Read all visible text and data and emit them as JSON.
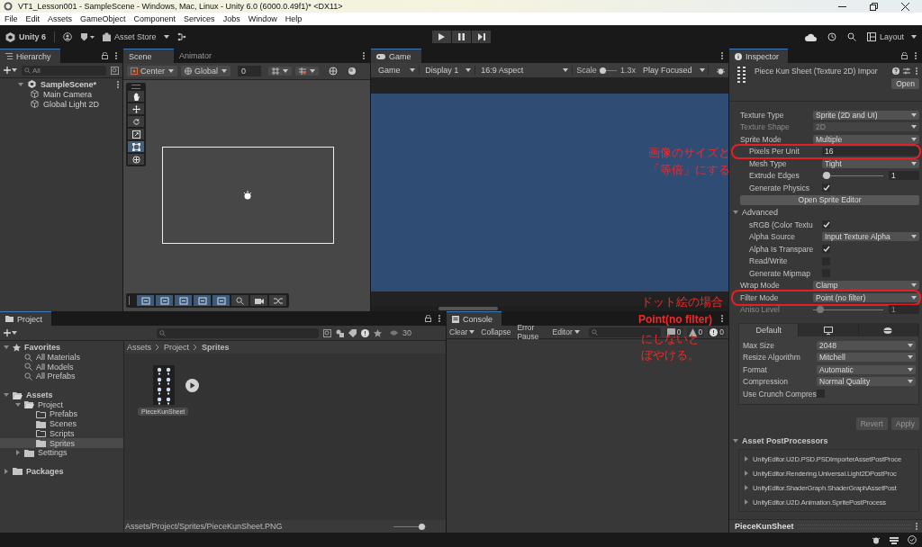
{
  "window": {
    "title": "VT1_Lesson001 - SampleScene - Windows, Mac, Linux - Unity 6.0 (6000.0.49f1)* <DX11>"
  },
  "menu": [
    "File",
    "Edit",
    "Assets",
    "GameObject",
    "Component",
    "Services",
    "Jobs",
    "Window",
    "Help"
  ],
  "toolbar": {
    "account": "Unity 6",
    "store": "Asset Store",
    "layout": "Layout"
  },
  "play_controls": [
    {
      "kind": "play"
    },
    {
      "kind": "pause"
    },
    {
      "kind": "step"
    }
  ],
  "hierarchy": {
    "tab": "Hierarchy",
    "search": {
      "placeholder": "All"
    },
    "tree": [
      {
        "label": "SampleScene*",
        "expanded": true,
        "children": [
          {
            "label": "Main Camera"
          },
          {
            "label": "Global Light 2D"
          }
        ]
      }
    ]
  },
  "scene": {
    "tabs": [
      {
        "label": "Scene",
        "selected": true
      },
      {
        "label": "Animator",
        "selected": false
      }
    ],
    "pivot": "Center",
    "space": "Global",
    "grid": "0",
    "tools": [
      {
        "kind": "hand",
        "selected": false
      },
      {
        "kind": "move",
        "selected": false
      },
      {
        "kind": "rotate",
        "selected": false
      },
      {
        "kind": "scale",
        "selected": false
      },
      {
        "kind": "rect",
        "selected": true
      },
      {
        "kind": "transform",
        "selected": false
      }
    ]
  },
  "game": {
    "tab": "Game",
    "view": "Game",
    "display": "Display 1",
    "aspect": "16:9 Aspect",
    "scale_label": "Scale",
    "scale": {
      "level": 0.12,
      "reading": "1.3x"
    },
    "mode": "Play Focused"
  },
  "inspector": {
    "tab": "Inspector",
    "title": "Piece Kun Sheet (Texture 2D) Impor",
    "open": "Open",
    "rows": [
      {
        "kind": "dropdown",
        "label": "Texture Type",
        "value": "Sprite (2D and UI)",
        "disabled": false,
        "annotated": false
      },
      {
        "kind": "dropdown",
        "label": "Texture Shape",
        "value": "2D",
        "disabled": true,
        "annotated": false
      },
      {
        "kind": "dropdown",
        "label": "Sprite Mode",
        "value": "Multiple",
        "disabled": false,
        "annotated": false,
        "children": [
          {
            "kind": "text",
            "label": "Pixels Per Unit",
            "value": "16",
            "disabled": false,
            "annotated": true
          },
          {
            "kind": "dropdown",
            "label": "Mesh Type",
            "value": "Tight",
            "disabled": false,
            "annotated": false
          },
          {
            "kind": "slider",
            "label": "Extrude Edges",
            "level": 0.02,
            "value": "1",
            "disabled": false,
            "annotated": false
          },
          {
            "kind": "checkbox",
            "label": "Generate Physics",
            "checked": true,
            "disabled": false,
            "annotated": false
          }
        ]
      },
      {
        "kind": "button",
        "label": "Open Sprite Editor"
      },
      {
        "kind": "foldout",
        "label": "Advanced",
        "expanded": true,
        "children": [
          {
            "kind": "checkbox",
            "label": "sRGB (Color Textu",
            "checked": true,
            "disabled": false,
            "annotated": false
          },
          {
            "kind": "dropdown",
            "label": "Alpha Source",
            "value": "Input Texture Alpha",
            "disabled": false,
            "annotated": false
          },
          {
            "kind": "checkbox",
            "label": "Alpha Is Transpare",
            "checked": true,
            "disabled": false,
            "annotated": false
          },
          {
            "kind": "checkbox",
            "label": "Read/Write",
            "checked": false,
            "disabled": false,
            "annotated": false
          },
          {
            "kind": "checkbox",
            "label": "Generate Mipmap",
            "checked": false,
            "disabled": false,
            "annotated": false
          }
        ]
      },
      {
        "kind": "dropdown",
        "label": "Wrap Mode",
        "value": "Clamp",
        "disabled": false,
        "annotated": false
      },
      {
        "kind": "dropdown",
        "label": "Filter Mode",
        "value": "Point (no filter)",
        "disabled": false,
        "annotated": true
      },
      {
        "kind": "slider",
        "label": "Aniso Level",
        "level": 0.05,
        "value": "1",
        "disabled": true,
        "annotated": false
      }
    ],
    "platform_tabs": [
      {
        "kind": "default",
        "label": "Default",
        "selected": true
      },
      {
        "kind": "standalone",
        "selected": false
      },
      {
        "kind": "web",
        "selected": false
      }
    ],
    "platform_rows": [
      {
        "kind": "dropdown",
        "label": "Max Size",
        "value": "2048"
      },
      {
        "kind": "dropdown",
        "label": "Resize Algorithm",
        "value": "Mitchell"
      },
      {
        "kind": "dropdown",
        "label": "Format",
        "value": "Automatic"
      },
      {
        "kind": "dropdown",
        "label": "Compression",
        "value": "Normal Quality"
      },
      {
        "kind": "checkbox",
        "label": "Use Crunch Compres",
        "checked": false
      }
    ],
    "actions": [
      {
        "label": "Revert",
        "disabled": true
      },
      {
        "label": "Apply",
        "disabled": true
      }
    ],
    "postprocessors": {
      "label": "Asset PostProcessors",
      "expanded": true,
      "items": [
        "UnityEditor.U2D.PSD.PSDImporterAssetPostProce",
        "UnityEditor.Rendering.Universal.Light2DPostProc",
        "UnityEditor.ShaderGraph.ShaderGraphAssetPost",
        "UnityEditor.U2D.Animation.SpritePostProcess"
      ]
    },
    "preview": "PieceKunSheet"
  },
  "project": {
    "tab": "Project",
    "count": "30",
    "tree": [
      {
        "kind": "star",
        "label": "Favorites",
        "expanded": true,
        "selected": false,
        "children": [
          {
            "kind": "search",
            "label": "All Materials",
            "selected": false
          },
          {
            "kind": "search",
            "label": "All Models",
            "selected": false
          },
          {
            "kind": "search",
            "label": "All Prefabs",
            "selected": false
          }
        ]
      },
      {
        "kind": "open-folder",
        "label": "Assets",
        "expanded": true,
        "selected": false,
        "children": [
          {
            "kind": "open-folder",
            "label": "Project",
            "expanded": true,
            "selected": false,
            "children": [
              {
                "kind": "empty-folder",
                "label": "Prefabs",
                "selected": false
              },
              {
                "kind": "folder",
                "label": "Scenes",
                "selected": false
              },
              {
                "kind": "empty-folder",
                "label": "Scripts",
                "selected": false
              },
              {
                "kind": "folder",
                "label": "Sprites",
                "selected": true
              }
            ]
          },
          {
            "kind": "folder",
            "label": "Settings",
            "expanded": false,
            "selected": false
          }
        ]
      },
      {
        "kind": "folder",
        "label": "Packages",
        "expanded": false,
        "selected": false
      }
    ],
    "breadcrumb": [
      "Assets",
      "Project",
      "Sprites"
    ],
    "assets": [
      {
        "kind": "sprite-sheet",
        "label": "PieceKunSheet"
      }
    ],
    "path": "Assets/Project/Sprites/PieceKunSheet.PNG",
    "zoom": {
      "level": 0.85
    }
  },
  "console": {
    "tab": "Console",
    "buttons": [
      "Clear",
      "Collapse",
      "Error Pause"
    ],
    "editor": "Editor",
    "counts": [
      {
        "kind": "info",
        "value": "0"
      },
      {
        "kind": "warning",
        "value": "0"
      },
      {
        "kind": "error",
        "value": "0"
      }
    ]
  },
  "annotations": [
    {
      "lines": [
        "画像のサイズと",
        "「等倍」にする"
      ]
    },
    {
      "lines": [
        "ドット絵の場合",
        "Point(no filter)",
        "にしないと",
        "ぼやける。"
      ]
    }
  ]
}
